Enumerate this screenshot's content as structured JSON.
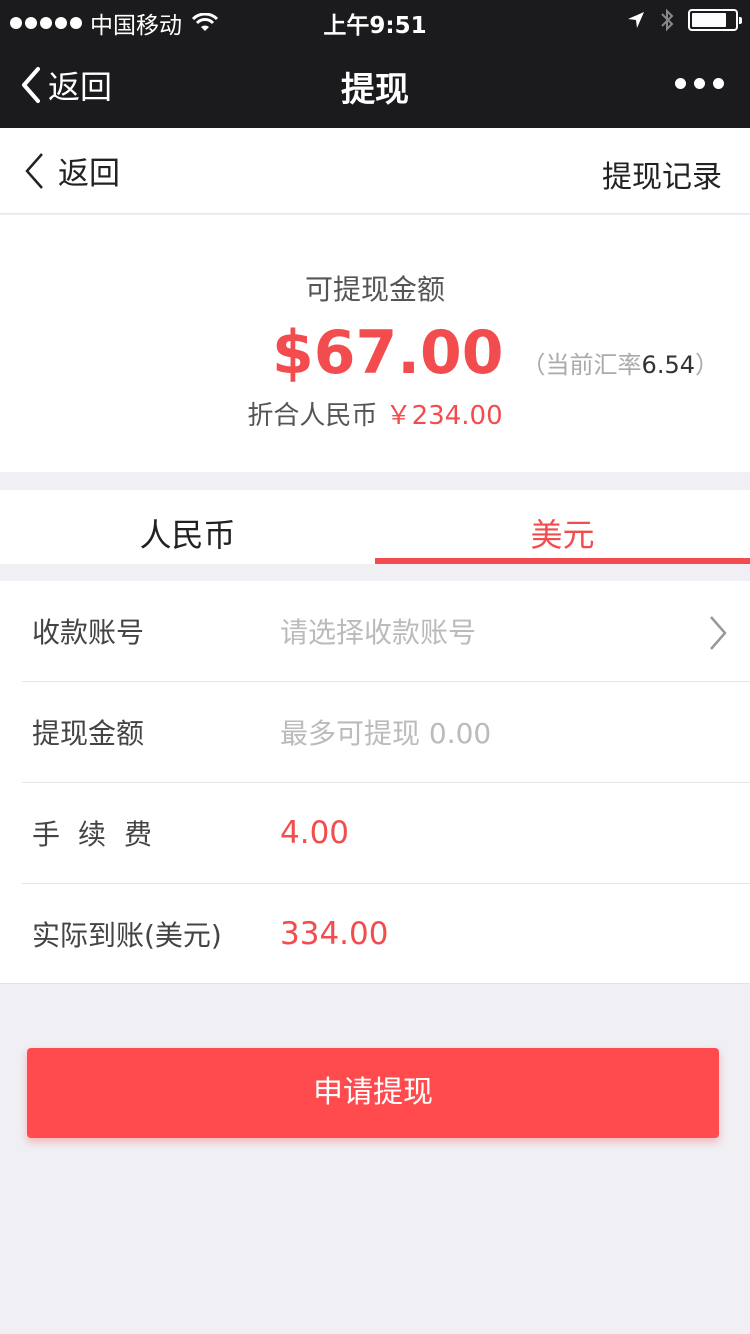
{
  "status_bar": {
    "carrier": "中国移动",
    "time": "上午9:51"
  },
  "navbar": {
    "back_label": "返回",
    "title": "提现"
  },
  "subheader": {
    "back_label": "返回",
    "record_label": "提现记录"
  },
  "balance": {
    "label": "可提现金额",
    "amount": "$67.00",
    "rate_prefix": "（当前汇率",
    "rate_value": "6.54",
    "rate_suffix": "）",
    "rmb_label": "折合人民币",
    "rmb_value": "￥234.00"
  },
  "tabs": [
    {
      "label": "人民币",
      "active": false
    },
    {
      "label": "美元",
      "active": true
    }
  ],
  "form": {
    "account": {
      "label": "收款账号",
      "placeholder": "请选择收款账号"
    },
    "amount": {
      "label": "提现金额",
      "placeholder": "最多可提现 0.00"
    },
    "fee": {
      "label": "手续费",
      "value": "4.00"
    },
    "actual": {
      "label": "实际到账(美元)",
      "value": "334.00"
    }
  },
  "submit_label": "申请提现",
  "colors": {
    "accent": "#f34c4e",
    "bar": "#1b1b1d",
    "background": "#efeff4"
  }
}
